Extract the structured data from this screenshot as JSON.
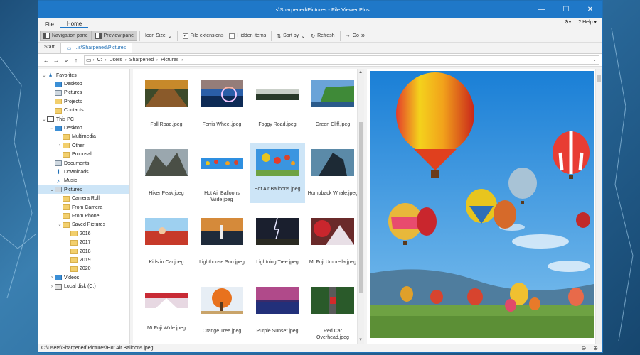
{
  "window": {
    "title": "...s\\Sharpened\\Pictures - File Viewer Plus",
    "buttons": {
      "minimize": "—",
      "maximize": "☐",
      "close": "✕"
    }
  },
  "menubar": {
    "items": [
      {
        "label": "File"
      },
      {
        "label": "Home",
        "active": true
      }
    ],
    "settings_icon": "settings-icon",
    "help_label": "Help"
  },
  "ribbon": {
    "navigation_pane": "Navigation pane",
    "preview_pane": "Preview pane",
    "icon_size": "Icon Size",
    "file_extensions": "File extensions",
    "hidden_items": "Hidden items",
    "sort_by": "Sort by",
    "refresh": "Refresh",
    "go_to": "Go to"
  },
  "tabs": [
    {
      "label": "Start",
      "active": false
    },
    {
      "label": "...s\\Sharpened\\Pictures",
      "active": true
    }
  ],
  "address": {
    "crumbs": [
      "C:",
      "Users",
      "Sharpened",
      "Pictures"
    ]
  },
  "tree": [
    {
      "label": "Favorites",
      "indent": 0,
      "twisty": "⌄",
      "icon": "star",
      "selected": false
    },
    {
      "label": "Desktop",
      "indent": 1,
      "twisty": "",
      "icon": "blue",
      "selected": false
    },
    {
      "label": "Pictures",
      "indent": 1,
      "twisty": "",
      "icon": "pic",
      "selected": false
    },
    {
      "label": "Projects",
      "indent": 1,
      "twisty": "",
      "icon": "folder",
      "selected": false
    },
    {
      "label": "Contacts",
      "indent": 1,
      "twisty": "",
      "icon": "folder",
      "selected": false
    },
    {
      "label": "This PC",
      "indent": 0,
      "twisty": "⌄",
      "icon": "pc",
      "selected": false
    },
    {
      "label": "Desktop",
      "indent": 1,
      "twisty": "⌄",
      "icon": "blue",
      "selected": false
    },
    {
      "label": "Multimedia",
      "indent": 2,
      "twisty": "",
      "icon": "folder",
      "selected": false
    },
    {
      "label": "Other",
      "indent": 2,
      "twisty": "›",
      "icon": "folder",
      "selected": false
    },
    {
      "label": "Proposal",
      "indent": 2,
      "twisty": "",
      "icon": "folder",
      "selected": false
    },
    {
      "label": "Documents",
      "indent": 1,
      "twisty": "",
      "icon": "pic",
      "selected": false
    },
    {
      "label": "Downloads",
      "indent": 1,
      "twisty": "",
      "icon": "down",
      "selected": false
    },
    {
      "label": "Music",
      "indent": 1,
      "twisty": "",
      "icon": "music",
      "selected": false
    },
    {
      "label": "Pictures",
      "indent": 1,
      "twisty": "⌄",
      "icon": "pic",
      "selected": true
    },
    {
      "label": "Camera Roll",
      "indent": 2,
      "twisty": "",
      "icon": "folder",
      "selected": false
    },
    {
      "label": "From Camera",
      "indent": 2,
      "twisty": "",
      "icon": "folder",
      "selected": false
    },
    {
      "label": "From Phone",
      "indent": 2,
      "twisty": "",
      "icon": "folder",
      "selected": false
    },
    {
      "label": "Saved Pictures",
      "indent": 2,
      "twisty": "⌄",
      "icon": "folder",
      "selected": false
    },
    {
      "label": "2016",
      "indent": 3,
      "twisty": "",
      "icon": "folder",
      "selected": false
    },
    {
      "label": "2017",
      "indent": 3,
      "twisty": "",
      "icon": "folder",
      "selected": false
    },
    {
      "label": "2018",
      "indent": 3,
      "twisty": "",
      "icon": "folder",
      "selected": false
    },
    {
      "label": "2019",
      "indent": 3,
      "twisty": "",
      "icon": "folder",
      "selected": false
    },
    {
      "label": "2020",
      "indent": 3,
      "twisty": "",
      "icon": "folder",
      "selected": false
    },
    {
      "label": "Videos",
      "indent": 1,
      "twisty": "›",
      "icon": "blue",
      "selected": false
    },
    {
      "label": "Local disk (C:)",
      "indent": 1,
      "twisty": "›",
      "icon": "drive",
      "selected": false
    }
  ],
  "files": [
    {
      "name": "Fall Road.jpeg",
      "thumb": "fall-road",
      "shape": "normal",
      "selected": false
    },
    {
      "name": "Ferris Wheel.jpeg",
      "thumb": "ferris",
      "shape": "normal",
      "selected": false
    },
    {
      "name": "Foggy Road.jpeg",
      "thumb": "foggy",
      "shape": "narrow",
      "selected": false
    },
    {
      "name": "Green Cliff.jpeg",
      "thumb": "cliff",
      "shape": "normal",
      "selected": false
    },
    {
      "name": "Hiker Peak.jpeg",
      "thumb": "hiker",
      "shape": "normal",
      "selected": false
    },
    {
      "name": "Hot Air Balloons Wide.jpeg",
      "thumb": "balloons-wide",
      "shape": "narrow",
      "selected": false
    },
    {
      "name": "Hot Air Balloons.jpeg",
      "thumb": "balloons",
      "shape": "normal",
      "selected": true
    },
    {
      "name": "Humpback Whale.jpeg",
      "thumb": "whale",
      "shape": "normal",
      "selected": false
    },
    {
      "name": "Kids in Car.jpeg",
      "thumb": "kids",
      "shape": "normal",
      "selected": false
    },
    {
      "name": "Lighthouse Sun.jpeg",
      "thumb": "lighthouse",
      "shape": "normal",
      "selected": false
    },
    {
      "name": "Lightning Tree.jpeg",
      "thumb": "lightning",
      "shape": "normal",
      "selected": false
    },
    {
      "name": "Mt Fuji Umbrella.jpeg",
      "thumb": "fuji",
      "shape": "normal",
      "selected": false
    },
    {
      "name": "Mt Fuji Wide.jpeg",
      "thumb": "fuji-wide",
      "shape": "wide",
      "selected": false
    },
    {
      "name": "Orange Tree.jpeg",
      "thumb": "tree",
      "shape": "normal",
      "selected": false
    },
    {
      "name": "Purple Sunset.jpeg",
      "thumb": "sunset",
      "shape": "normal",
      "selected": false
    },
    {
      "name": "Red Car Overhead.jpeg",
      "thumb": "redcar",
      "shape": "normal",
      "selected": false
    }
  ],
  "status": {
    "path": "C:\\Users\\Sharpened\\Pictures\\Hot Air Balloons.jpeg",
    "zoom_out_icon": "zoom-out-icon",
    "zoom_in_icon": "zoom-in-icon"
  },
  "colors": {
    "accent": "#1f78c8",
    "selection": "#cde5f7"
  }
}
